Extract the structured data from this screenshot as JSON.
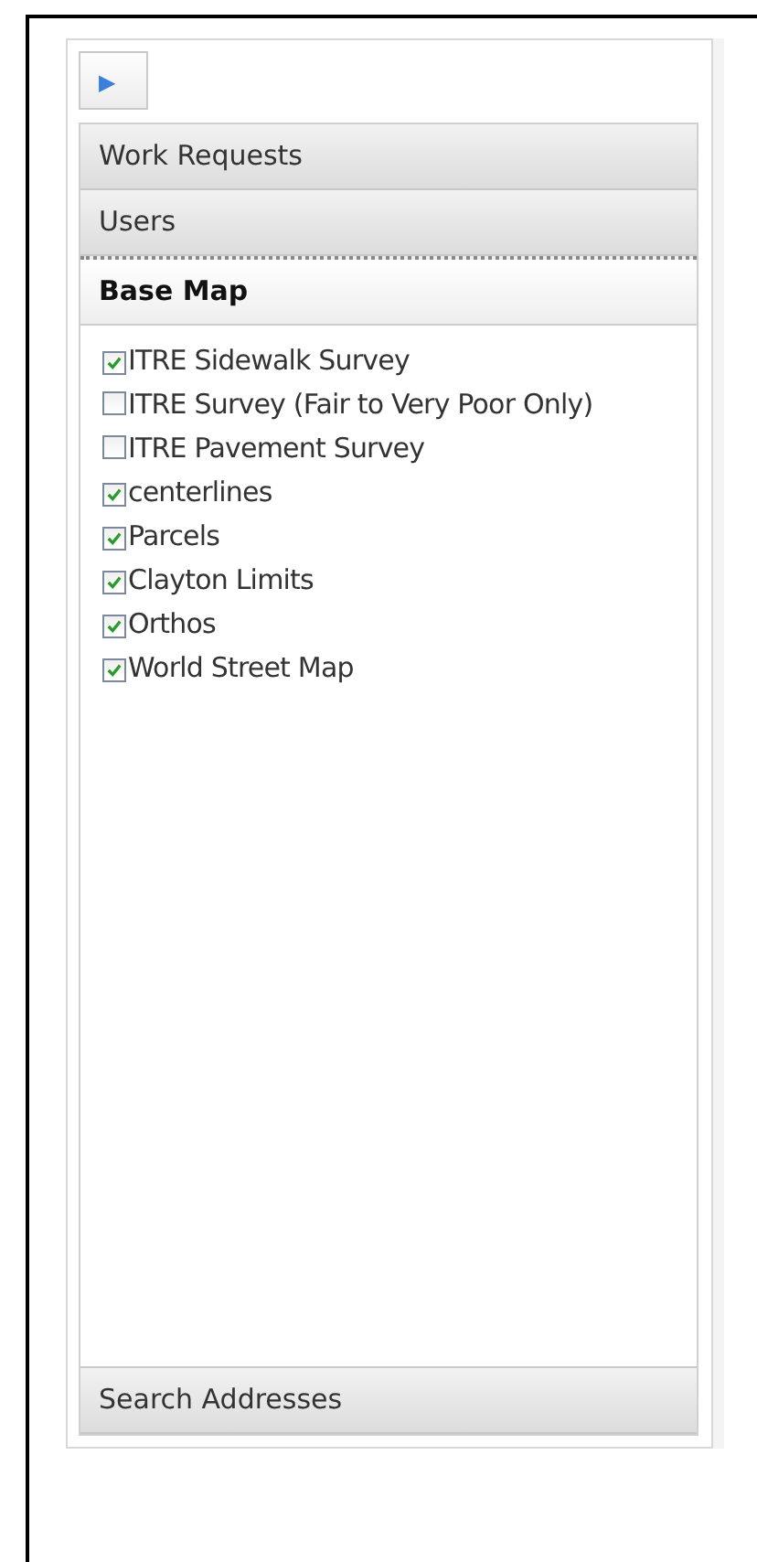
{
  "toggle_button": {
    "icon": "▶"
  },
  "sections": [
    {
      "title": "Work Requests",
      "selected": false
    },
    {
      "title": "Users",
      "selected": false
    },
    {
      "title": "Base Map",
      "selected": true,
      "layers": [
        {
          "label": "ITRE Sidewalk Survey",
          "checked": true
        },
        {
          "label": "ITRE Survey (Fair to Very Poor Only)",
          "checked": false
        },
        {
          "label": "ITRE Pavement Survey",
          "checked": false
        },
        {
          "label": "centerlines",
          "checked": true
        },
        {
          "label": "Parcels",
          "checked": true
        },
        {
          "label": "Clayton Limits",
          "checked": true
        },
        {
          "label": "Orthos",
          "checked": true
        },
        {
          "label": "World Street Map",
          "checked": true
        }
      ]
    },
    {
      "title": "Search Addresses",
      "selected": false
    }
  ]
}
